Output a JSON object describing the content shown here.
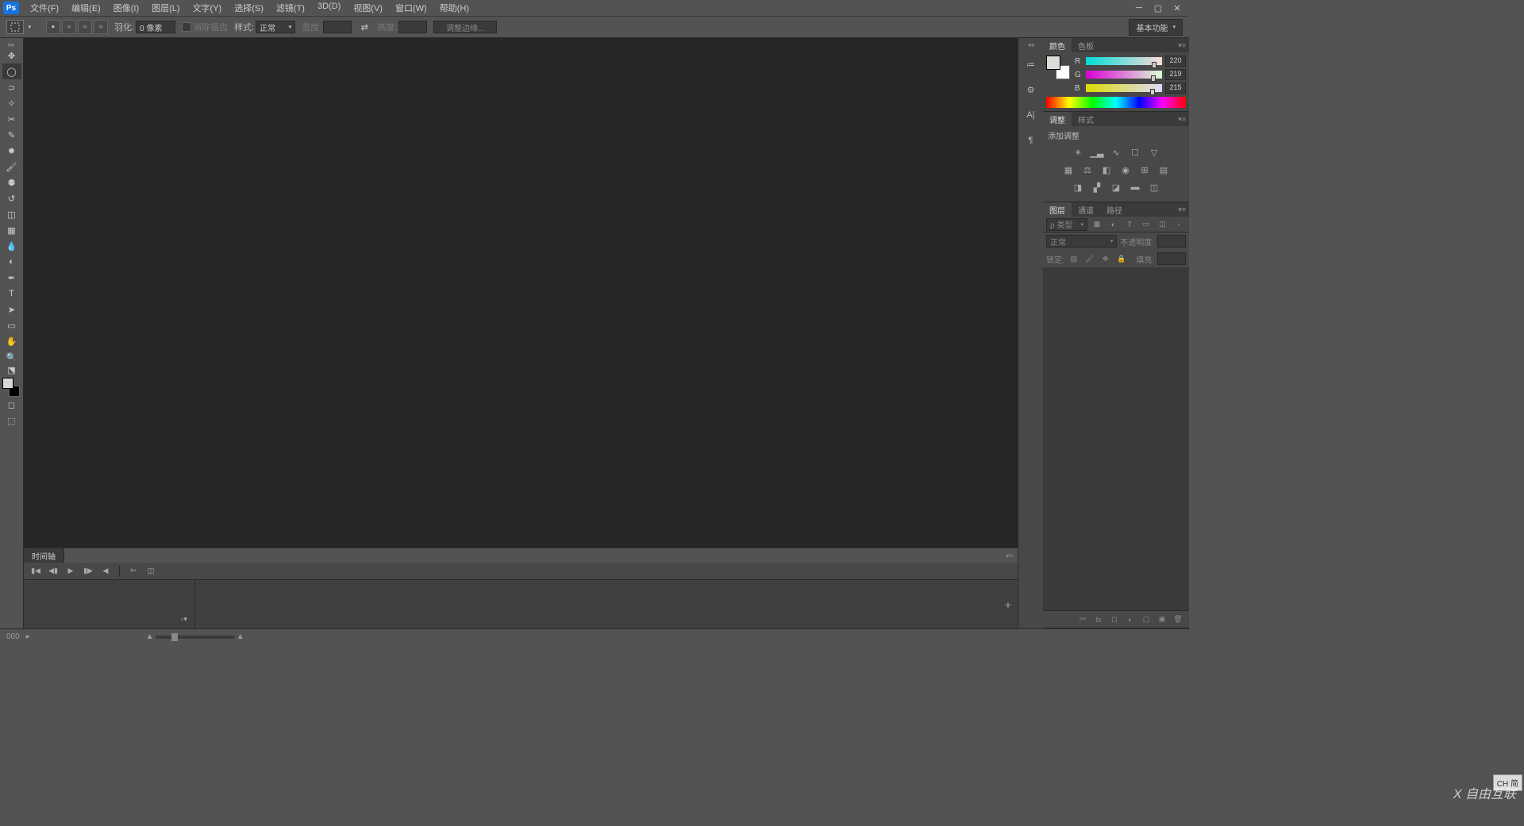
{
  "app": {
    "logo": "Ps"
  },
  "menus": {
    "file": "文件(F)",
    "edit": "编辑(E)",
    "image": "图像(I)",
    "layer": "图层(L)",
    "type": "文字(Y)",
    "select": "选择(S)",
    "filter": "滤镜(T)",
    "threeD": "3D(D)",
    "view": "视图(V)",
    "window": "窗口(W)",
    "help": "帮助(H)"
  },
  "options": {
    "feather_label": "羽化:",
    "feather_value": "0 像素",
    "antialias": "消除锯齿",
    "style_label": "样式:",
    "style_value": "正常",
    "width_label": "宽度:",
    "height_label": "高度:",
    "refine_edge": "调整边缘...",
    "workspace": "基本功能"
  },
  "timeline": {
    "tab": "时间轴"
  },
  "status": {
    "zoom": "000"
  },
  "panels": {
    "color_tab": "颜色",
    "swatches_tab": "色板",
    "r": "R",
    "r_val": "220",
    "g": "G",
    "g_val": "219",
    "b": "B",
    "b_val": "215",
    "adjustments_tab": "调整",
    "styles_tab": "样式",
    "add_adjustment": "添加调整",
    "layers_tab": "图层",
    "channels_tab": "通道",
    "paths_tab": "路径",
    "filter_kind": "ρ 类型",
    "blend_mode": "正常",
    "opacity_label": "不透明度:",
    "lock_label": "锁定:",
    "fill_label": "填充:"
  },
  "ime": "CH 简",
  "watermark": "X 自由互联"
}
